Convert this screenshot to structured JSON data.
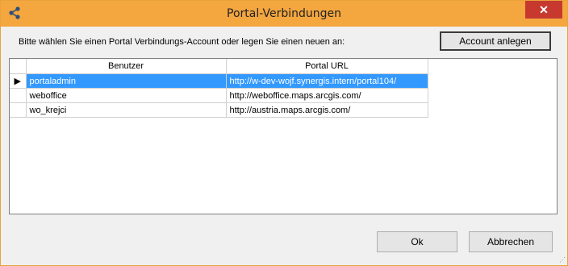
{
  "window": {
    "title": "Portal-Verbindungen",
    "app_icon": "share-icon",
    "close_icon": "close-icon"
  },
  "prompt": "Bitte wählen Sie einen Portal Verbindungs-Account oder legen Sie einen neuen an:",
  "buttons": {
    "account_anlegen": "Account anlegen",
    "ok": "Ok",
    "abbrechen": "Abbrechen"
  },
  "grid": {
    "columns": [
      "Benutzer",
      "Portal URL"
    ],
    "rows": [
      {
        "indicator": "▶",
        "user": "portaladmin",
        "url": "http://w-dev-wojf.synergis.intern/portal104/",
        "selected": true
      },
      {
        "indicator": "",
        "user": "weboffice",
        "url": "http://weboffice.maps.arcgis.com/",
        "selected": false
      },
      {
        "indicator": "",
        "user": "wo_krejci",
        "url": "http://austria.maps.arcgis.com/",
        "selected": false
      }
    ]
  },
  "colors": {
    "titlebar": "#f4a63f",
    "selection": "#3399ff",
    "close": "#c7392f"
  }
}
